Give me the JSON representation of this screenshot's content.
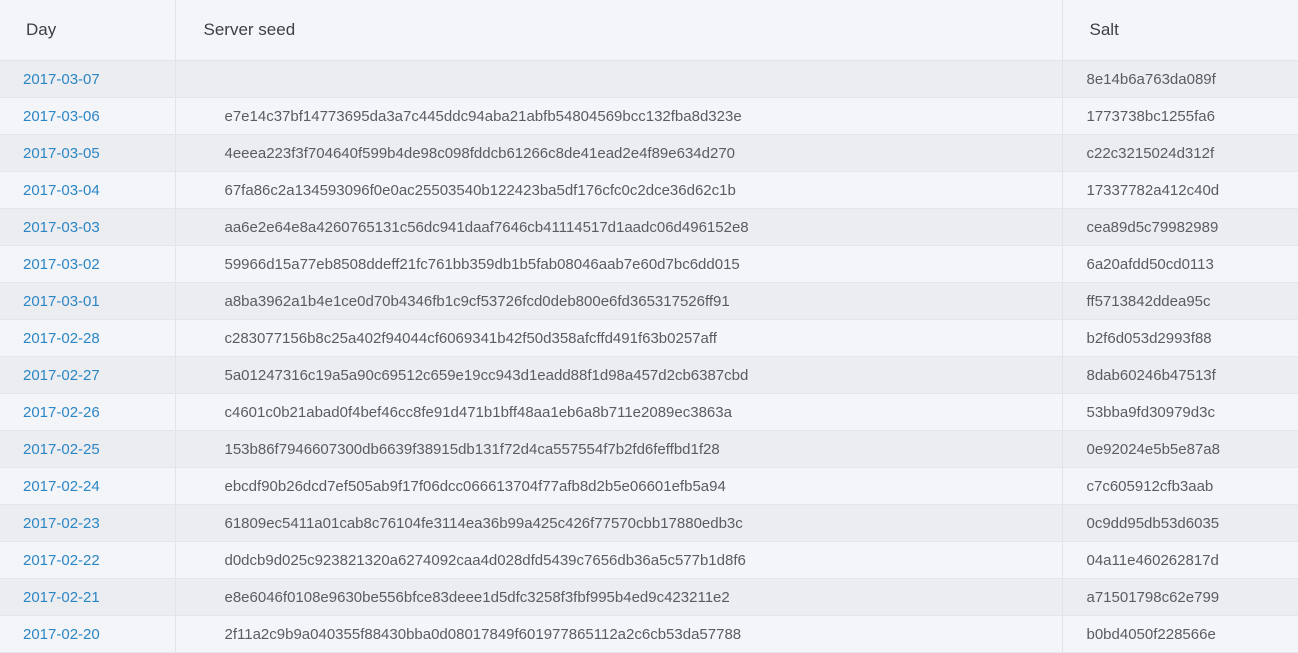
{
  "table": {
    "headers": {
      "day": "Day",
      "server_seed": "Server seed",
      "salt": "Salt"
    },
    "rows": [
      {
        "day": "2017-03-07",
        "server_seed": "",
        "salt": "8e14b6a763da089f"
      },
      {
        "day": "2017-03-06",
        "server_seed": "e7e14c37bf14773695da3a7c445ddc94aba21abfb54804569bcc132fba8d323e",
        "salt": "1773738bc1255fa6"
      },
      {
        "day": "2017-03-05",
        "server_seed": "4eeea223f3f704640f599b4de98c098fddcb61266c8de41ead2e4f89e634d270",
        "salt": "c22c3215024d312f"
      },
      {
        "day": "2017-03-04",
        "server_seed": "67fa86c2a134593096f0e0ac25503540b122423ba5df176cfc0c2dce36d62c1b",
        "salt": "17337782a412c40d"
      },
      {
        "day": "2017-03-03",
        "server_seed": "aa6e2e64e8a4260765131c56dc941daaf7646cb41114517d1aadc06d496152e8",
        "salt": "cea89d5c79982989"
      },
      {
        "day": "2017-03-02",
        "server_seed": "59966d15a77eb8508ddeff21fc761bb359db1b5fab08046aab7e60d7bc6dd015",
        "salt": "6a20afdd50cd0113"
      },
      {
        "day": "2017-03-01",
        "server_seed": "a8ba3962a1b4e1ce0d70b4346fb1c9cf53726fcd0deb800e6fd365317526ff91",
        "salt": "ff5713842ddea95c"
      },
      {
        "day": "2017-02-28",
        "server_seed": "c283077156b8c25a402f94044cf6069341b42f50d358afcffd491f63b0257aff",
        "salt": "b2f6d053d2993f88"
      },
      {
        "day": "2017-02-27",
        "server_seed": "5a01247316c19a5a90c69512c659e19cc943d1eadd88f1d98a457d2cb6387cbd",
        "salt": "8dab60246b47513f"
      },
      {
        "day": "2017-02-26",
        "server_seed": "c4601c0b21abad0f4bef46cc8fe91d471b1bff48aa1eb6a8b711e2089ec3863a",
        "salt": "53bba9fd30979d3c"
      },
      {
        "day": "2017-02-25",
        "server_seed": "153b86f7946607300db6639f38915db131f72d4ca557554f7b2fd6feffbd1f28",
        "salt": "0e92024e5b5e87a8"
      },
      {
        "day": "2017-02-24",
        "server_seed": "ebcdf90b26dcd7ef505ab9f17f06dcc066613704f77afb8d2b5e06601efb5a94",
        "salt": "c7c605912cfb3aab"
      },
      {
        "day": "2017-02-23",
        "server_seed": "61809ec5411a01cab8c76104fe3114ea36b99a425c426f77570cbb17880edb3c",
        "salt": "0c9dd95db53d6035"
      },
      {
        "day": "2017-02-22",
        "server_seed": "d0dcb9d025c923821320a6274092caa4d028dfd5439c7656db36a5c577b1d8f6",
        "salt": "04a11e460262817d"
      },
      {
        "day": "2017-02-21",
        "server_seed": "e8e6046f0108e9630be556bfce83deee1d5dfc3258f3fbf995b4ed9c423211e2",
        "salt": "a71501798c62e799"
      },
      {
        "day": "2017-02-20",
        "server_seed": "2f11a2c9b9a040355f88430bba0d08017849f601977865112a2c6cb53da57788",
        "salt": "b0bd4050f228566e"
      }
    ]
  },
  "colors": {
    "link": "#2b86c5",
    "text": "#5a5c63",
    "header_text": "#3d3f45",
    "row_odd": "#ecedf1",
    "row_even": "#f4f5f9"
  }
}
